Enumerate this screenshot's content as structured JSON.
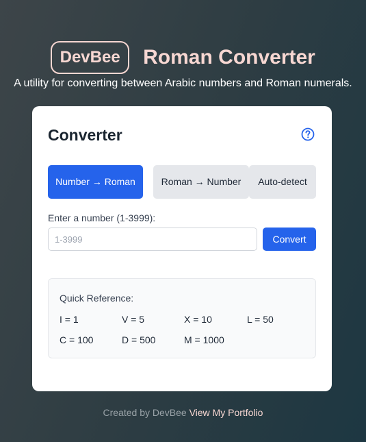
{
  "header": {
    "logo_text": "DevBee",
    "title": "Roman Converter",
    "subtitle": "A utility for converting between Arabic numbers and Roman numerals."
  },
  "card": {
    "title": "Converter",
    "help_icon": "question-circle-icon",
    "tabs": [
      {
        "label": "Number → Roman",
        "active": true
      },
      {
        "label": "Roman → Number",
        "active": false
      },
      {
        "label": "Auto-detect",
        "active": false
      }
    ],
    "input": {
      "label": "Enter a number (1-3999):",
      "placeholder": "1-3999",
      "value": ""
    },
    "convert_label": "Convert",
    "reference": {
      "title": "Quick Reference:",
      "items": [
        "I = 1",
        "V = 5",
        "X = 10",
        "L = 50",
        "C = 100",
        "D = 500",
        "M = 1000"
      ]
    }
  },
  "footer": {
    "text": "Created by DevBee",
    "link_label": "View My Portfolio"
  },
  "colors": {
    "accent": "#2563eb",
    "brand": "#f7d7d2",
    "tab_inactive": "#e5e7eb"
  }
}
